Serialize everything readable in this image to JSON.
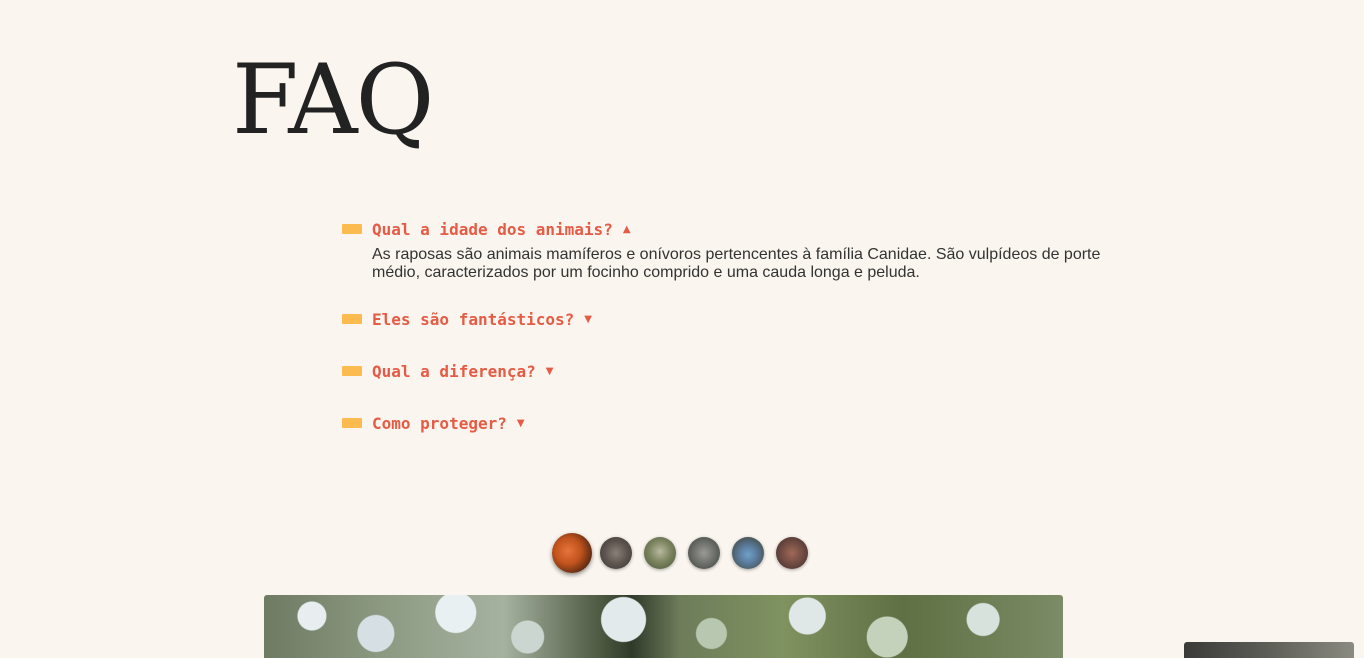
{
  "page": {
    "title": "FAQ"
  },
  "faq": {
    "items": [
      {
        "question": "Qual a idade dos animais?",
        "caret": "▲",
        "expanded": true,
        "answer": "As raposas são animais mamíferos e onívoros pertencentes à família Canidae. São vulpídeos de porte médio, caracterizados por um focinho comprido e uma cauda longa e peluda."
      },
      {
        "question": "Eles são fantásticos?",
        "caret": "▼",
        "expanded": false
      },
      {
        "question": "Qual a diferença?",
        "caret": "▼",
        "expanded": false
      },
      {
        "question": "Como proteger?",
        "caret": "▼",
        "expanded": false
      }
    ]
  },
  "gallery": {
    "thumbnails": [
      {
        "name": "fox",
        "active": true
      },
      {
        "name": "raccoon",
        "active": false
      },
      {
        "name": "bear",
        "active": false
      },
      {
        "name": "wolf",
        "active": false
      },
      {
        "name": "mandrill",
        "active": false
      },
      {
        "name": "monkey",
        "active": false
      }
    ]
  },
  "colors": {
    "background": "#faf5ee",
    "accent": "#e55b45",
    "marker": "#fbbb4e",
    "text": "#222222"
  }
}
